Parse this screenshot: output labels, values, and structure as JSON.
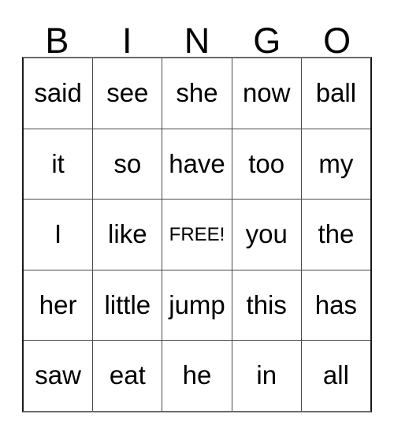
{
  "card": {
    "header_letters": [
      "B",
      "I",
      "N",
      "G",
      "O"
    ],
    "rows": [
      [
        "said",
        "see",
        "she",
        "now",
        "ball"
      ],
      [
        "it",
        "so",
        "have",
        "too",
        "my"
      ],
      [
        "I",
        "like",
        "FREE!",
        "you",
        "the"
      ],
      [
        "her",
        "little",
        "jump",
        "this",
        "has"
      ],
      [
        "saw",
        "eat",
        "he",
        "in",
        "all"
      ]
    ],
    "free_space": {
      "row": 2,
      "column": 2,
      "label": "FREE!"
    },
    "colors": {
      "background": "#ffffff",
      "text": "#000000",
      "grid_line": "#4a4a4a",
      "outer_border": "#1a1a1a"
    }
  }
}
